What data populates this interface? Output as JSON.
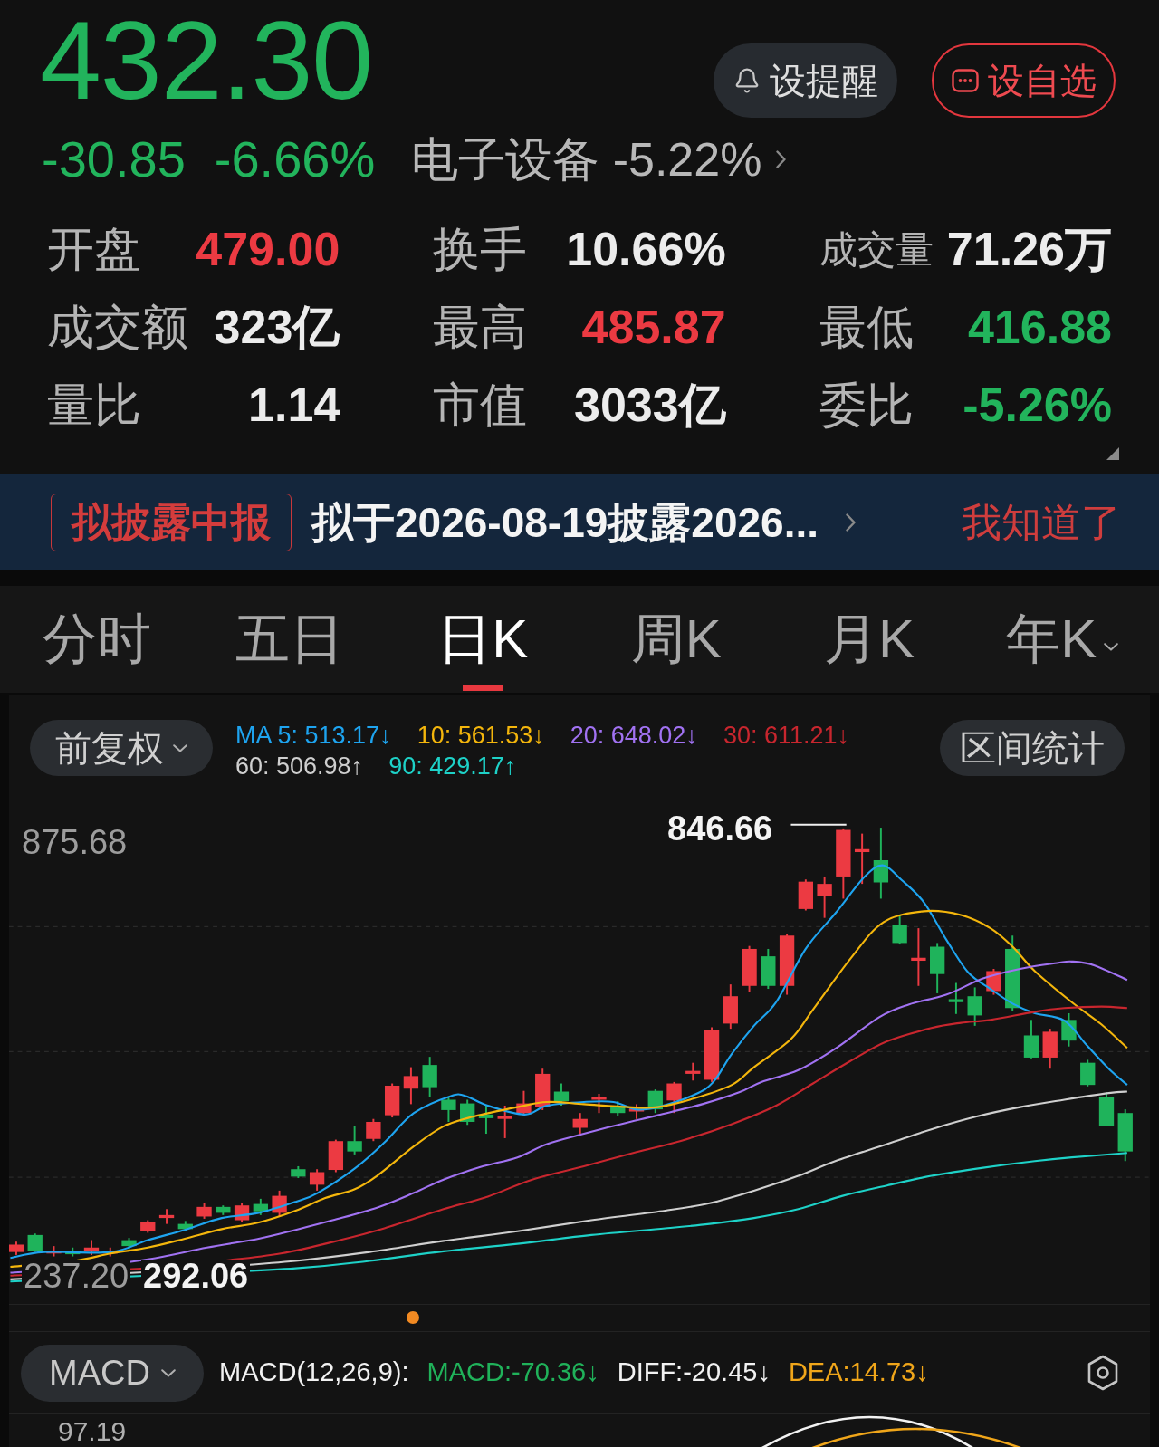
{
  "quote": {
    "price": "432.30",
    "change": "-30.85",
    "change_pct": "-6.66%",
    "falling": true,
    "sector_link": "电子设备 -5.22%"
  },
  "actions": [
    {
      "label": "设提醒",
      "kind": "alert"
    },
    {
      "label": "设自选",
      "kind": "watchlist"
    }
  ],
  "stats": [
    {
      "label": "开盘",
      "value": "479.00",
      "color": "#ec3a42",
      "compact": false
    },
    {
      "label": "换手",
      "value": "10.66%",
      "color": "#ececec",
      "compact": false
    },
    {
      "label": "成交量",
      "value": "71.26万",
      "color": "#ececec",
      "compact": true
    },
    {
      "label": "成交额",
      "value": "323亿",
      "color": "#ececec",
      "compact": false
    },
    {
      "label": "最高",
      "value": "485.87",
      "color": "#ec3a42",
      "compact": false
    },
    {
      "label": "最低",
      "value": "416.88",
      "color": "#22b45c",
      "compact": false
    },
    {
      "label": "量比",
      "value": "1.14",
      "color": "#ececec",
      "compact": false
    },
    {
      "label": "市值",
      "value": "3033亿",
      "color": "#ececec",
      "compact": false
    },
    {
      "label": "委比",
      "value": "-5.26%",
      "color": "#22b45c",
      "compact": false
    }
  ],
  "notice": {
    "badge": "拟披露中报",
    "text": "拟于2026-08-19披露2026...",
    "dismiss": "我知道了"
  },
  "period_tabs": [
    {
      "label": "分时",
      "selected": false,
      "dropdown": false
    },
    {
      "label": "五日",
      "selected": false,
      "dropdown": false
    },
    {
      "label": "日K",
      "selected": true,
      "dropdown": false
    },
    {
      "label": "周K",
      "selected": false,
      "dropdown": false
    },
    {
      "label": "月K",
      "selected": false,
      "dropdown": false
    },
    {
      "label": "年K",
      "selected": false,
      "dropdown": true
    }
  ],
  "chart_controls": {
    "adjustment": "前复权",
    "range_stats": "区间统计"
  },
  "ma_legend": [
    {
      "label": "MA 5: 513.17↓",
      "color": "#1ea4f0"
    },
    {
      "label": "10: 561.53↓",
      "color": "#f4b60c"
    },
    {
      "label": "20: 648.02↓",
      "color": "#a172f2"
    },
    {
      "label": "30: 611.21↓",
      "color": "#c8262e"
    },
    {
      "label": "60: 506.98↑",
      "color": "#cfcfcf"
    },
    {
      "label": "90: 429.17↑",
      "color": "#1ed2c8"
    }
  ],
  "kline_chart": {
    "axis_max": "875.68",
    "axis_min": "237.20",
    "high_label": "846.66",
    "low_label": "292.06"
  },
  "indicator": {
    "name": "MACD",
    "params": "MACD(12,26,9):",
    "values": [
      {
        "label": "MACD:-70.36↓",
        "color": "#20b25a"
      },
      {
        "label": "DIFF:-20.45↓",
        "color": "#f2f2f2"
      },
      {
        "label": "DEA:14.73↓",
        "color": "#f0a61a"
      }
    ],
    "axis_max": "97.19"
  }
}
